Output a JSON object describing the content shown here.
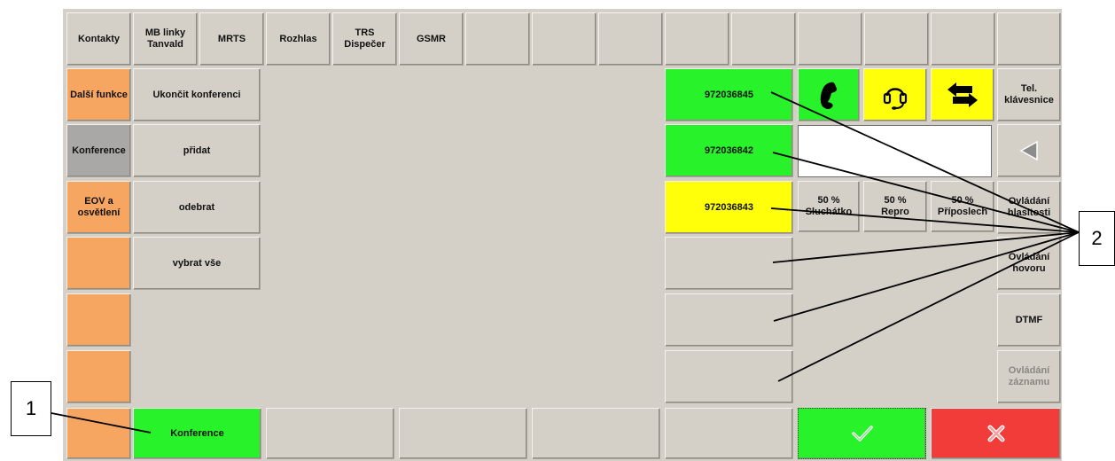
{
  "top_tabs": [
    "Kontakty",
    "MB linky\nTanvald",
    "MRTS",
    "Rozhlas",
    "TRS\nDispečer",
    "GSMR"
  ],
  "left_buttons": [
    "Další funkce",
    "Konference",
    "EOV a\nosvětlení"
  ],
  "conference_buttons": [
    "Ukončit konferenci",
    "přidat",
    "odebrat",
    "vybrat vše"
  ],
  "bottom": {
    "conference_label": "Konference"
  },
  "calls": [
    {
      "number": "972036845",
      "state": "green"
    },
    {
      "number": "972036842",
      "state": "green"
    },
    {
      "number": "972036843",
      "state": "yellow"
    }
  ],
  "phone_number_input": "",
  "volume_buttons": [
    "50 %\nSluchátko",
    "50 %\nRepro",
    "50 %\nPříposlech"
  ],
  "right_column": [
    "Tel.\nklávesnice",
    "Ovládání\nhlasitosti",
    "Ovládání\nhovoru",
    "DTMF",
    "Ovládání\nzáznamu"
  ],
  "icons": {
    "handset": "phone-handset-icon",
    "headset": "headset-icon",
    "transfer": "transfer-arrows-icon",
    "back": "left-triangle-icon",
    "confirm": "check-icon",
    "cancel": "close-x-icon"
  },
  "colors": {
    "orange": "#f7a662",
    "green": "#27f22a",
    "yellow": "#ffff0a",
    "red": "#f23c3a",
    "grey": "#a9a8a6"
  },
  "callouts": {
    "one": "1",
    "two": "2"
  }
}
